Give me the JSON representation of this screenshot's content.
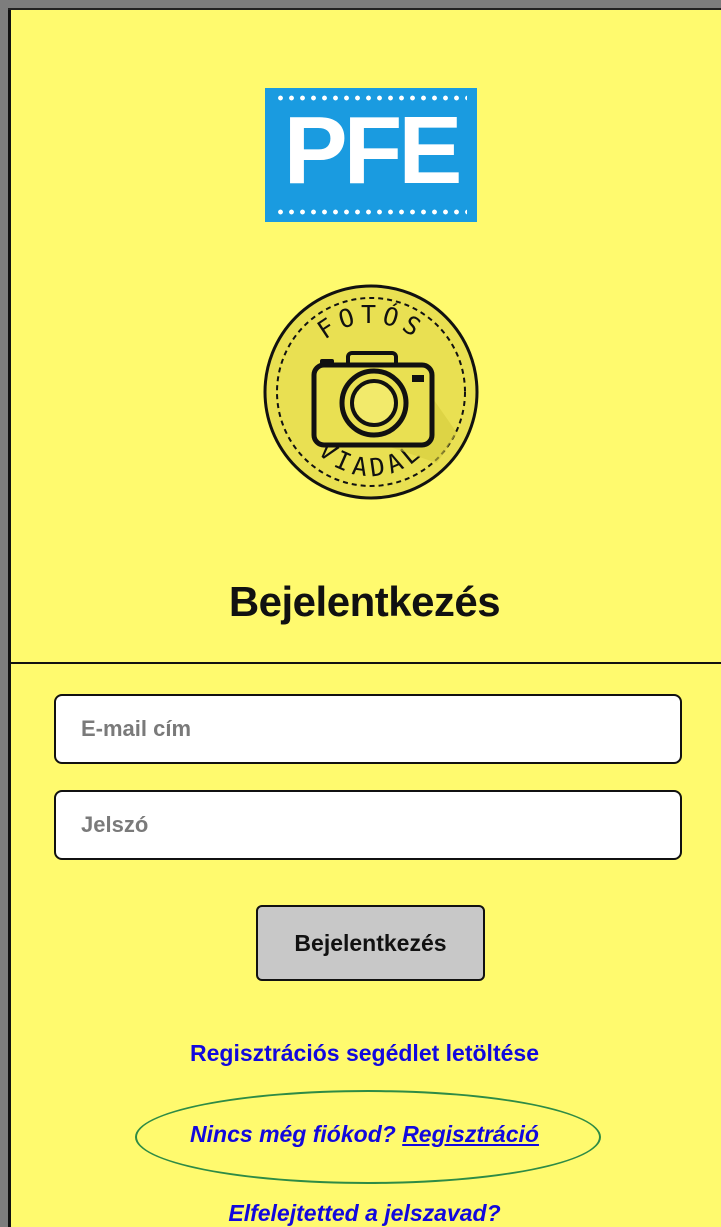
{
  "logo": {
    "text": "PFE",
    "color": "#1a9be0"
  },
  "badge": {
    "top_text": "FOTÓS",
    "bottom_text": "VIADAL",
    "icon": "camera-icon"
  },
  "page": {
    "title": "Bejelentkezés",
    "background": "#fffa6e"
  },
  "form": {
    "email_placeholder": "E-mail cím",
    "password_placeholder": "Jelszó",
    "submit_label": "Bejelentkezés"
  },
  "links": {
    "guide": "Regisztrációs segédlet letöltése",
    "no_account": "Nincs még fiókod?",
    "register": "Regisztráció",
    "forgot": "Elfelejtetted a jelszavad?",
    "color": "#1208dd"
  },
  "annotation": {
    "color": "#2e8b45"
  }
}
